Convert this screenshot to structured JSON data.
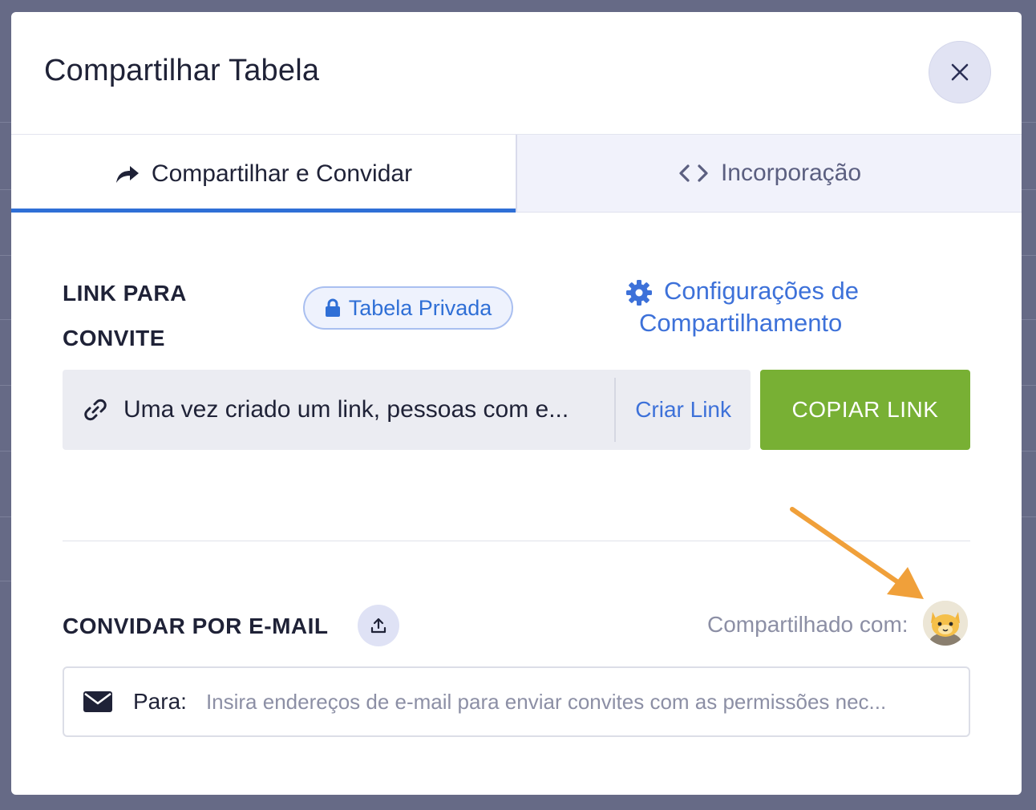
{
  "modal": {
    "title": "Compartilhar Tabela"
  },
  "tabs": [
    {
      "label": "Compartilhar e Convidar",
      "icon": "share-arrow-icon",
      "active": true
    },
    {
      "label": "Incorporação",
      "icon": "code-icon",
      "active": false
    }
  ],
  "invite_link": {
    "section_label": "LINK PARA CONVITE",
    "privacy_badge": "Tabela Privada",
    "settings_link_line1": "Configurações de",
    "settings_link_line2": "Compartilhamento",
    "link_text": "Uma vez criado um link, pessoas com e...",
    "create_link_label": "Criar Link",
    "copy_button_label": "COPIAR LINK"
  },
  "email_invite": {
    "section_label": "CONVIDAR POR E-MAIL",
    "shared_with_label": "Compartilhado com:",
    "to_label": "Para:",
    "placeholder": "Insira endereços de e-mail para enviar convites com as permissões nec..."
  },
  "colors": {
    "accent": "#2f6fd6",
    "copy_button": "#78b034",
    "annotation_arrow": "#f0a03a",
    "overlay": "#666a86"
  }
}
